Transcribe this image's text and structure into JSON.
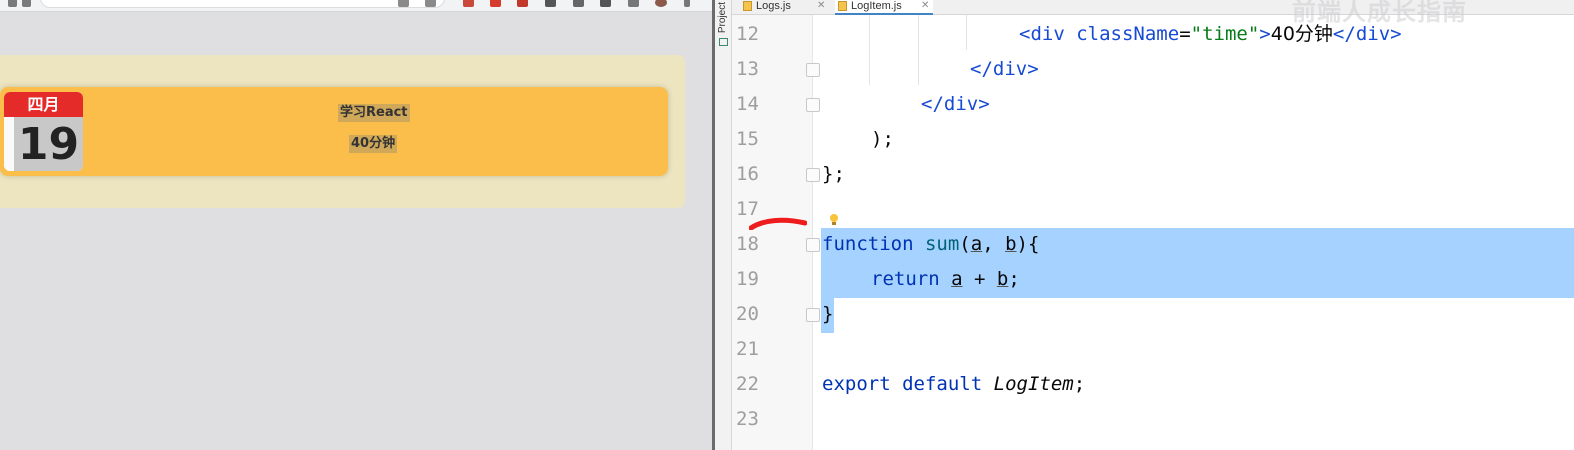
{
  "browser": {
    "log_item": {
      "month": "四月",
      "day": "19",
      "title": "学习React",
      "duration": "40分钟"
    },
    "colors": {
      "panel": "#ede5bf",
      "item": "#fcbe4a",
      "month_header": "#e52a2a"
    }
  },
  "ide": {
    "sidebar_label": "Project",
    "tabs": [
      {
        "label": "Logs.js",
        "icon": "js-file-icon",
        "active": false
      },
      {
        "label": "LogItem.js",
        "icon": "js-file-icon",
        "active": true
      }
    ],
    "watermark": "前端人成长指南",
    "line_numbers": [
      "12",
      "13",
      "14",
      "15",
      "16",
      "17",
      "18",
      "19",
      "20",
      "21",
      "22",
      "23"
    ],
    "code": {
      "l12": {
        "open": "<",
        "tag": "div",
        "attr": "className",
        "eq": "=",
        "str": "\"time\"",
        "text_open": ">",
        "text": "40分钟",
        "close_open": "</",
        "close_tag": "div",
        "close_end": ">"
      },
      "l13": {
        "open": "</",
        "tag": "div",
        "end": ">"
      },
      "l14": {
        "open": "</",
        "tag": "div",
        "end": ">"
      },
      "l15": {
        "text": ");"
      },
      "l16": {
        "text": "};"
      },
      "l18": {
        "kw": "function",
        "fn": "sum",
        "p_open": "(",
        "a": "a",
        "comma": ", ",
        "b": "b",
        "rest": "){"
      },
      "l19": {
        "kw": "return",
        "a": "a",
        "plus": " + ",
        "b": "b",
        "end": ";"
      },
      "l20": {
        "text": "}"
      },
      "l22": {
        "kw1": "export",
        "kw2": "default",
        "ident": "LogItem",
        "end": ";"
      }
    },
    "selection_color": "#a6d2ff"
  }
}
